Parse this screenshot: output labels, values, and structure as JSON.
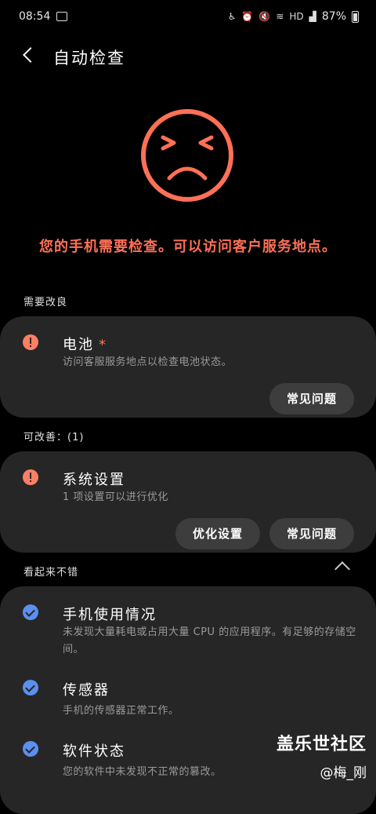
{
  "status_bar": {
    "time": "08:54",
    "battery": "87%",
    "network": "HD"
  },
  "header": {
    "title": "自动检查"
  },
  "alert": {
    "message": "您的手机需要检查。可以访问客户服务地点。"
  },
  "sections": {
    "needs_improvement": "需要改良",
    "can_improve": "可改善：(1)",
    "looks_good": "看起来不错"
  },
  "battery_item": {
    "title": "电池",
    "star": "*",
    "desc": "访问客服服务地点以检查电池状态。",
    "faq": "常见问题"
  },
  "system_item": {
    "title": "系统设置",
    "desc": "1 项设置可以进行优化",
    "optimize": "优化设置",
    "faq": "常见问题"
  },
  "usage_item": {
    "title": "手机使用情况",
    "desc": "未发现大量耗电或占用大量 CPU 的应用程序。有足够的存储空间。"
  },
  "sensor_item": {
    "title": "传感器",
    "desc": "手机的传感器正常工作。"
  },
  "software_item": {
    "title": "软件状态",
    "desc": "您的软件中未发现不正常的篡改。"
  },
  "watermark": {
    "main": "盖乐世社区",
    "sub": "@梅_刚"
  },
  "colors": {
    "alert": "#ff7057",
    "check": "#5b8ff0",
    "card": "#262626",
    "button": "#3d3d3d"
  }
}
